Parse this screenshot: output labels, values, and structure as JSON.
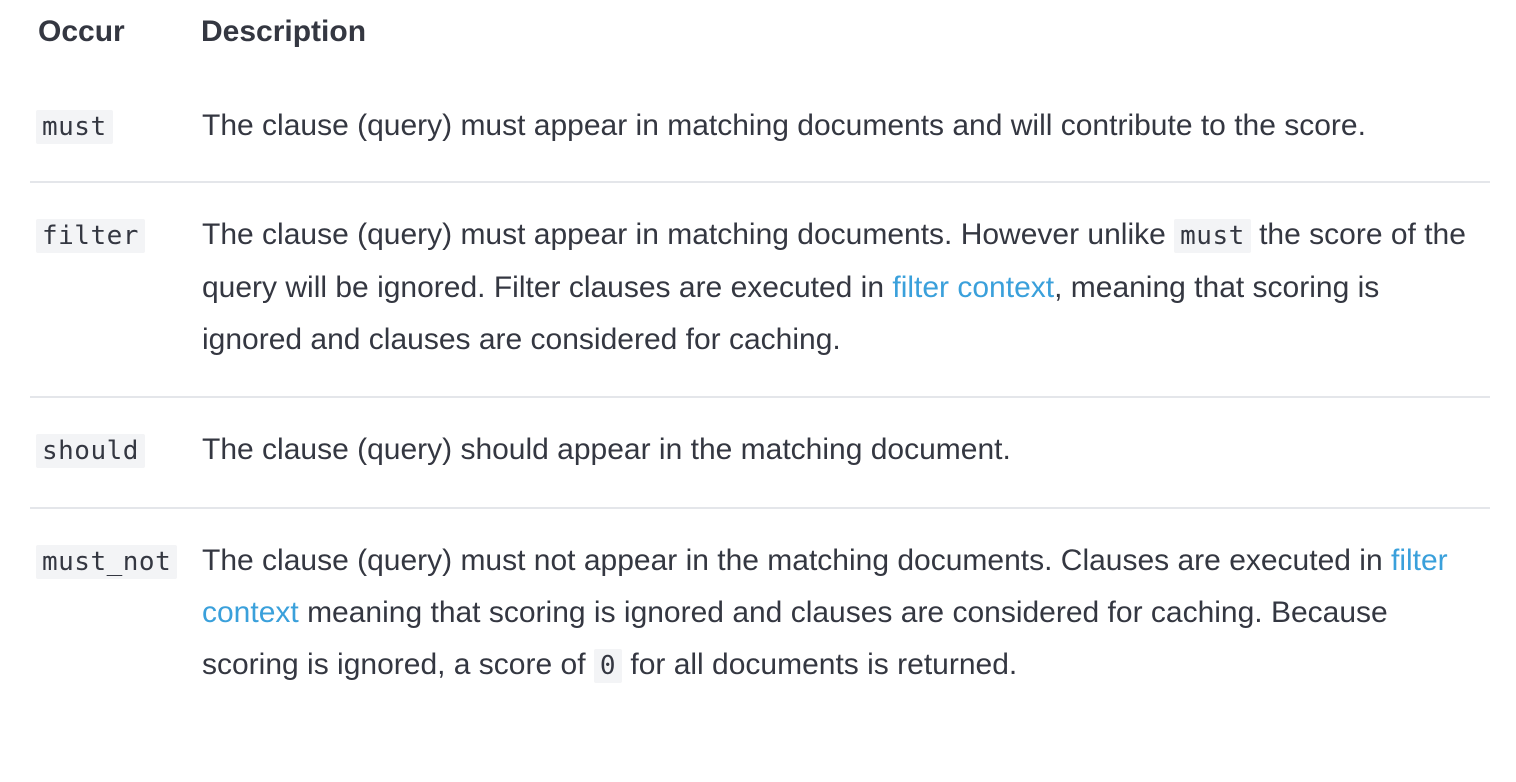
{
  "table": {
    "headers": {
      "occur": "Occur",
      "description": "Description"
    },
    "rows": [
      {
        "occur": "must",
        "description": {
          "text1": "The clause (query) must appear in matching documents and will contribute to the score."
        }
      },
      {
        "occur": "filter",
        "description": {
          "text1": "The clause (query) must appear in matching documents. However unlike ",
          "code1": "must",
          "text2": " the score of the query will be ignored. Filter clauses are executed in ",
          "link1": "filter context",
          "text3": ", meaning that scoring is ignored and clauses are considered for caching."
        }
      },
      {
        "occur": "should",
        "description": {
          "text1": "The clause (query) should appear in the matching document."
        }
      },
      {
        "occur": "must_not",
        "description": {
          "text1": "The clause (query) must not appear in the matching documents. Clauses are executed in ",
          "link1": "filter context",
          "text2": " meaning that scoring is ignored and clauses are considered for caching. Because scoring is ignored, a score of ",
          "code1": "0",
          "text3": " for all documents is returned."
        }
      }
    ]
  }
}
